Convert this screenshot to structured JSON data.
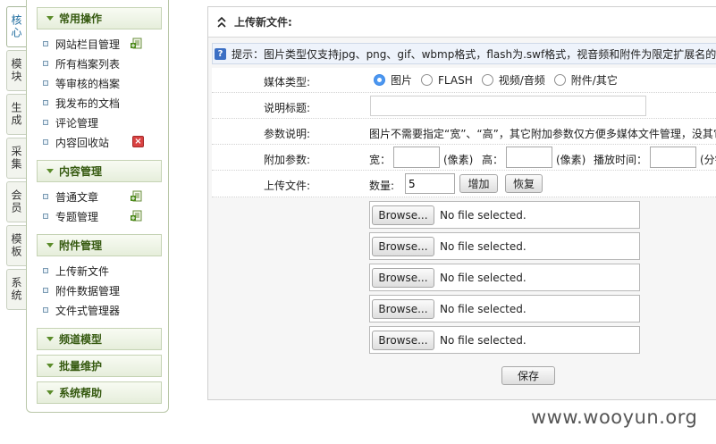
{
  "vtabs": [
    "核心",
    "模块",
    "生成",
    "采集",
    "会员",
    "模板",
    "系统"
  ],
  "sidebar": {
    "groups": [
      {
        "title": "常用操作"
      },
      {
        "title": "内容管理"
      },
      {
        "title": "附件管理"
      },
      {
        "title": "频道模型"
      },
      {
        "title": "批量维护"
      },
      {
        "title": "系统帮助"
      }
    ],
    "common_items": [
      "网站栏目管理",
      "所有档案列表",
      "等审核的档案",
      "我发布的文档",
      "评论管理",
      "内容回收站"
    ],
    "content_items": [
      "普通文章",
      "专题管理"
    ],
    "attach_items": [
      "上传新文件",
      "附件数据管理",
      "文件式管理器"
    ],
    "icons": {
      "add": "add-document-icon",
      "delete": "recycle-bin-icon"
    }
  },
  "main": {
    "title": "上传新文件:",
    "tip": "提示：图片类型仅支持jpg、png、gif、wbmp格式，flash为.swf格式，视音频和附件为限定扩展名的类型",
    "media_label": "媒体类型:",
    "media_options": [
      "图片",
      "FLASH",
      "视频/音频",
      "附件/其它"
    ],
    "media_selected": "图片",
    "caption_label": "说明标题:",
    "caption_value": "",
    "params_desc_label": "参数说明:",
    "params_desc": "图片不需要指定“宽”、“高”，其它附加参数仅方便多媒体文件管理，没其它",
    "extra_label": "附加参数:",
    "width_label": "宽：",
    "px_unit": "(像素)",
    "height_label": "高：",
    "play_label": "播放时间：",
    "min_unit": "(分钟",
    "upload_label": "上传文件:",
    "count_label": "数量:",
    "count_value": "5",
    "add_label": "增加",
    "reset_label": "恢复",
    "browse_label": "Browse...",
    "no_file": "No file selected.",
    "save_label": "保存"
  },
  "watermark": "www.wooyun.org",
  "colors": {
    "accent_green": "#35590f",
    "tab_active": "#1e6c9e",
    "radio_on": "#4c97f0"
  }
}
